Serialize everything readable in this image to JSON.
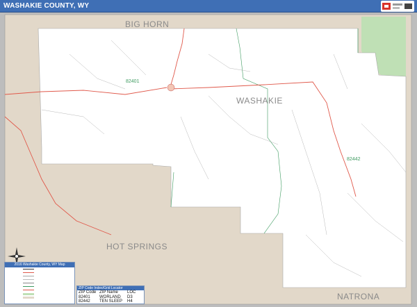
{
  "header": {
    "title": "WASHAKIE COUNTY, WY"
  },
  "colors": {
    "header_bg": "#3f6fb5",
    "county_land": "#ffffff",
    "neighbor_land": "#e2d8c9",
    "park": "#bfe0b5",
    "highway": "#e0584a",
    "roads": "#a6a6a6",
    "zip_boundary": "#3c9a5f"
  },
  "labels": {
    "county": "WASHAKIE",
    "north_neighbor": "BIG HORN",
    "south_west_neighbor": "HOT SPRINGS",
    "south_neighbor": "NATRONA"
  },
  "zip_labels": {
    "worland": "82401",
    "ten_sleep": "82442"
  },
  "legend": {
    "title": "2016 Washakie County, WY Map",
    "rows": [
      "",
      "",
      "",
      "",
      "",
      "",
      "",
      "",
      "",
      ""
    ]
  },
  "zip_table": {
    "title": "ZIP Code Index/Grid Locator",
    "headers": [
      "ZIP Code",
      "ZIP Name",
      "LOC"
    ],
    "rows": [
      [
        "82401",
        "WORLAND",
        "D3"
      ],
      [
        "82442",
        "TEN SLEEP",
        "H4"
      ]
    ]
  },
  "icons": {
    "compass": "compass-rose-icon",
    "logo": "publisher-logo-icon"
  }
}
